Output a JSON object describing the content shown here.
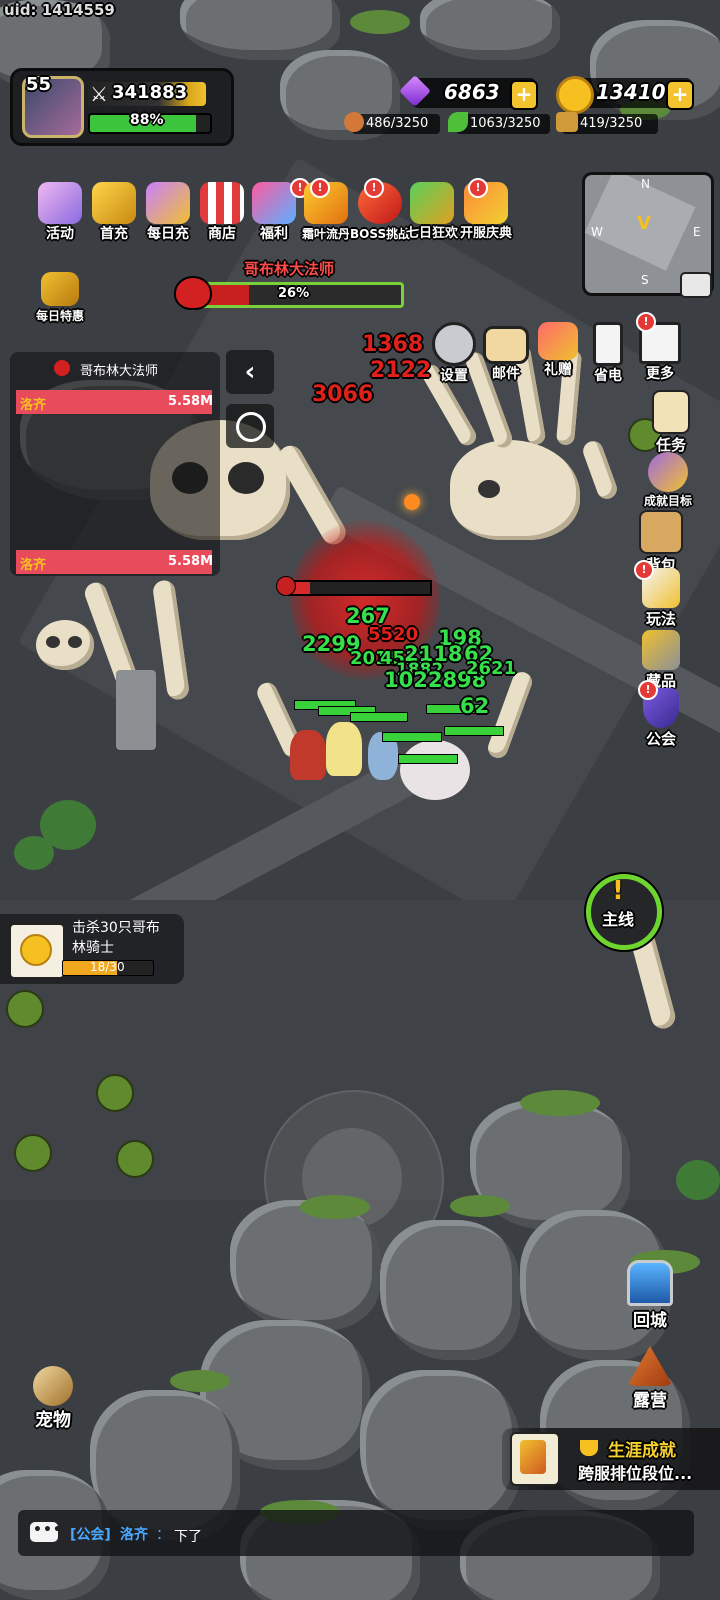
{
  "uid": "uid: 1414559",
  "player": {
    "level": "55",
    "power": "341883",
    "exp_percent": "88%",
    "exp_fraction": 0.88
  },
  "currency": {
    "gems": "6863",
    "gold": "13410"
  },
  "resources": {
    "meat": "486/3250",
    "leaf": "1063/3250",
    "wood": "419/3250"
  },
  "top_icons": [
    {
      "label": "活动",
      "badge": false
    },
    {
      "label": "首充",
      "badge": false
    },
    {
      "label": "每日充",
      "badge": false
    },
    {
      "label": "商店",
      "badge": false
    },
    {
      "label": "福利",
      "badge": true
    },
    {
      "label": "霜叶流丹",
      "badge": true
    },
    {
      "label": "BOSS挑战",
      "badge": true
    },
    {
      "label": "七日狂欢",
      "badge": false
    },
    {
      "label": "开服庆典",
      "badge": true
    }
  ],
  "daily_deal": "每日特惠",
  "boss": {
    "name": "哥布林大法师",
    "hp_percent": "26%",
    "hp_fraction": 0.26
  },
  "rank_panel": {
    "title": "哥布林大法师",
    "rows": [
      {
        "name": "洛齐",
        "value": "5.58M"
      },
      {
        "name": "洛齐",
        "value": "5.58M"
      }
    ]
  },
  "settings_row": [
    {
      "label": "设置",
      "badge": false
    },
    {
      "label": "邮件",
      "badge": false
    },
    {
      "label": "礼赠",
      "badge": false
    },
    {
      "label": "省电",
      "badge": false
    },
    {
      "label": "更多",
      "badge": true
    }
  ],
  "right_menu": [
    {
      "label": "任务",
      "badge": false
    },
    {
      "label": "成就目标",
      "badge": false
    },
    {
      "label": "背包",
      "badge": false
    },
    {
      "label": "玩法",
      "badge": true
    },
    {
      "label": "藏品",
      "badge": false
    },
    {
      "label": "公会",
      "badge": true
    }
  ],
  "minimap": {
    "n": "N",
    "e": "E",
    "s": "S",
    "w": "W"
  },
  "damage_numbers": [
    "1368",
    "2122",
    "3066",
    "267",
    "2299",
    "5520",
    "198",
    "2018",
    "4511",
    "2118",
    "62",
    "1882",
    "1022898",
    "2621",
    "62"
  ],
  "quest": {
    "text": "击杀30只哥布林骑士",
    "progress": "18/30",
    "fraction": 0.6
  },
  "main_quest": "主线",
  "back_city": "回城",
  "camp": "露营",
  "pet": "宠物",
  "achievement": {
    "title": "生涯成就",
    "subtitle": "跨服排位段位..."
  },
  "chat": {
    "channel": "[公会]",
    "name": "洛齐",
    "sep": "：",
    "message": "下了"
  }
}
